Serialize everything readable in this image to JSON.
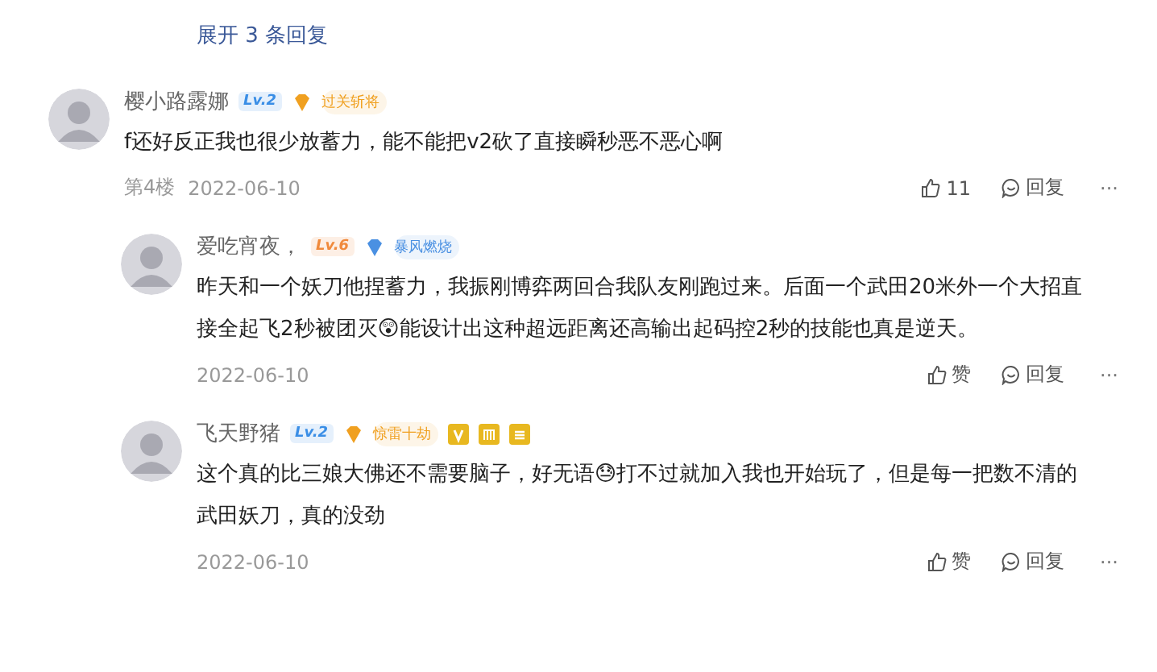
{
  "expand_replies": "展开 3 条回复",
  "comments": [
    {
      "nested": false,
      "name": "樱小路露娜",
      "level": {
        "text": "Lv.2",
        "color": "#3a8ee6"
      },
      "medal": {
        "text": "过关斩将",
        "color": "#f0a020"
      },
      "body": "f还好反正我也很少放蓄力，能不能把v2砍了直接瞬秒恶不恶心啊",
      "floor": "第4楼",
      "date": "2022-06-10",
      "like": "11",
      "reply": "回复",
      "more": "···"
    },
    {
      "nested": true,
      "name": "爱吃宵夜，",
      "level": {
        "text": "Lv.6",
        "color": "#f08a3c"
      },
      "medal": {
        "text": "暴风燃烧",
        "color": "#4a90e2"
      },
      "body": "昨天和一个妖刀他捏蓄力，我振刚博弈两回合我队友刚跑过来。后面一个武田20米外一个大招直接全起飞2秒被团灭😲能设计出这种超远距离还高输出起码控2秒的技能也真是逆天。",
      "date": "2022-06-10",
      "like": "赞",
      "reply": "回复",
      "more": "···"
    },
    {
      "nested": true,
      "name": "飞天野猪",
      "level": {
        "text": "Lv.2",
        "color": "#3a8ee6"
      },
      "medal": {
        "text": "惊雷十劫",
        "color": "#f0a020"
      },
      "extra_badges": [
        {
          "kind": "v"
        },
        {
          "kind": "m"
        },
        {
          "kind": "eq"
        }
      ],
      "body": "这个真的比三娘大佛还不需要脑子，好无语😓打不过就加入我也开始玩了，但是每一把数不清的武田妖刀，真的没劲",
      "date": "2022-06-10",
      "like": "赞",
      "reply": "回复",
      "more": "···"
    }
  ]
}
